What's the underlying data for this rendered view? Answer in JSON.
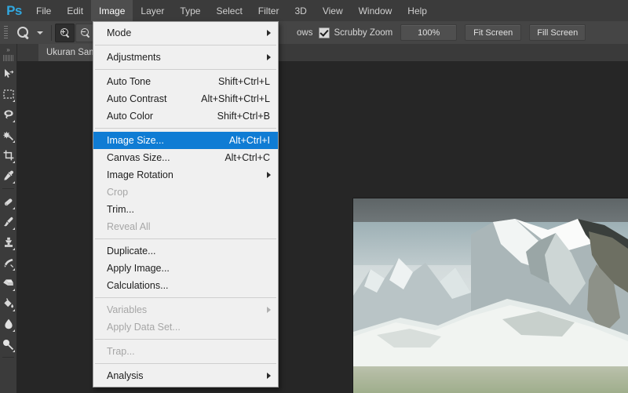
{
  "app": {
    "logo": "Ps"
  },
  "menubar": {
    "items": [
      {
        "label": "File",
        "active": false
      },
      {
        "label": "Edit",
        "active": false
      },
      {
        "label": "Image",
        "active": true
      },
      {
        "label": "Layer",
        "active": false
      },
      {
        "label": "Type",
        "active": false
      },
      {
        "label": "Select",
        "active": false
      },
      {
        "label": "Filter",
        "active": false
      },
      {
        "label": "3D",
        "active": false
      },
      {
        "label": "View",
        "active": false
      },
      {
        "label": "Window",
        "active": false
      },
      {
        "label": "Help",
        "active": false
      }
    ]
  },
  "options_bar": {
    "tool_icon": "magnifier-icon",
    "tool_preset_dropdown": "chevron-down-icon",
    "zoom_in_button": "zoom-in-icon",
    "zoom_out_button": "zoom-out-icon",
    "occluded_label": "ows",
    "scrubby_zoom": {
      "label": "Scrubby Zoom",
      "checked": true
    },
    "buttons": [
      {
        "label": "100%"
      },
      {
        "label": "Fit Screen"
      },
      {
        "label": "Fill Screen"
      }
    ]
  },
  "document_tab": {
    "title": "Ukuran Sam"
  },
  "tools": [
    {
      "name": "move-tool",
      "icon": "move-icon"
    },
    {
      "name": "rectangular-marquee-tool",
      "icon": "marquee-icon"
    },
    {
      "name": "lasso-tool",
      "icon": "lasso-icon"
    },
    {
      "name": "magic-wand-tool",
      "icon": "magic-wand-icon"
    },
    {
      "name": "crop-tool",
      "icon": "crop-icon"
    },
    {
      "name": "eyedropper-tool",
      "icon": "eyedropper-icon"
    },
    {
      "name": "healing-brush-tool",
      "icon": "healing-brush-icon"
    },
    {
      "name": "brush-tool",
      "icon": "brush-icon"
    },
    {
      "name": "clone-stamp-tool",
      "icon": "clone-stamp-icon"
    },
    {
      "name": "history-brush-tool",
      "icon": "history-brush-icon"
    },
    {
      "name": "eraser-tool",
      "icon": "eraser-icon"
    },
    {
      "name": "gradient-tool",
      "icon": "paint-bucket-icon"
    },
    {
      "name": "blur-tool",
      "icon": "blur-droplet-icon"
    },
    {
      "name": "dodge-tool",
      "icon": "dodge-icon"
    }
  ],
  "image_menu": {
    "items": [
      {
        "label": "Mode",
        "accel": "",
        "submenu": true,
        "disabled": false,
        "selected": false,
        "sep_after": true
      },
      {
        "label": "Adjustments",
        "accel": "",
        "submenu": true,
        "disabled": false,
        "selected": false,
        "sep_after": true
      },
      {
        "label": "Auto Tone",
        "accel": "Shift+Ctrl+L",
        "submenu": false,
        "disabled": false,
        "selected": false,
        "sep_after": false
      },
      {
        "label": "Auto Contrast",
        "accel": "Alt+Shift+Ctrl+L",
        "submenu": false,
        "disabled": false,
        "selected": false,
        "sep_after": false
      },
      {
        "label": "Auto Color",
        "accel": "Shift+Ctrl+B",
        "submenu": false,
        "disabled": false,
        "selected": false,
        "sep_after": true
      },
      {
        "label": "Image Size...",
        "accel": "Alt+Ctrl+I",
        "submenu": false,
        "disabled": false,
        "selected": true,
        "sep_after": false
      },
      {
        "label": "Canvas Size...",
        "accel": "Alt+Ctrl+C",
        "submenu": false,
        "disabled": false,
        "selected": false,
        "sep_after": false
      },
      {
        "label": "Image Rotation",
        "accel": "",
        "submenu": true,
        "disabled": false,
        "selected": false,
        "sep_after": false
      },
      {
        "label": "Crop",
        "accel": "",
        "submenu": false,
        "disabled": true,
        "selected": false,
        "sep_after": false
      },
      {
        "label": "Trim...",
        "accel": "",
        "submenu": false,
        "disabled": false,
        "selected": false,
        "sep_after": false
      },
      {
        "label": "Reveal All",
        "accel": "",
        "submenu": false,
        "disabled": true,
        "selected": false,
        "sep_after": true
      },
      {
        "label": "Duplicate...",
        "accel": "",
        "submenu": false,
        "disabled": false,
        "selected": false,
        "sep_after": false
      },
      {
        "label": "Apply Image...",
        "accel": "",
        "submenu": false,
        "disabled": false,
        "selected": false,
        "sep_after": false
      },
      {
        "label": "Calculations...",
        "accel": "",
        "submenu": false,
        "disabled": false,
        "selected": false,
        "sep_after": true
      },
      {
        "label": "Variables",
        "accel": "",
        "submenu": true,
        "disabled": true,
        "selected": false,
        "sep_after": false
      },
      {
        "label": "Apply Data Set...",
        "accel": "",
        "submenu": false,
        "disabled": true,
        "selected": false,
        "sep_after": true
      },
      {
        "label": "Trap...",
        "accel": "",
        "submenu": false,
        "disabled": true,
        "selected": false,
        "sep_after": true
      },
      {
        "label": "Analysis",
        "accel": "",
        "submenu": true,
        "disabled": false,
        "selected": false,
        "sep_after": false
      }
    ]
  },
  "colors": {
    "menu_bar_bg": "#3b3b3b",
    "options_bar_bg": "#454545",
    "canvas_bg": "#262626",
    "menu_bg": "#f0f0f0",
    "highlight": "#0f7cd4",
    "logo_blue": "#31a8e0"
  },
  "canvas_image": {
    "subject": "snow-covered-mountain-photo"
  }
}
